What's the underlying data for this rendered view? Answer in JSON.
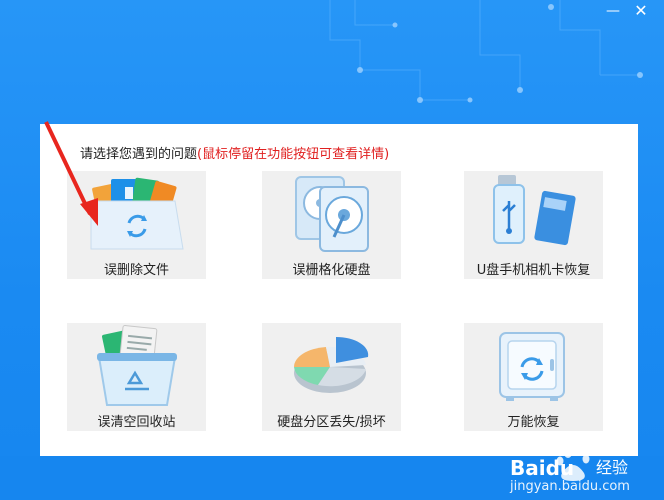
{
  "window": {
    "minimize_glyph": "—",
    "close_glyph": "✕"
  },
  "panel": {
    "prompt": "请选择您遇到的问题",
    "hint": "(鼠标停留在功能按钮可查看详情)"
  },
  "options": [
    {
      "label": "误删除文件",
      "icon": "folder-recycle-icon"
    },
    {
      "label": "误栅格化硬盘",
      "icon": "hard-disk-icon"
    },
    {
      "label": "U盘手机相机卡恢复",
      "icon": "usb-sdcard-icon"
    },
    {
      "label": "误清空回收站",
      "icon": "recycle-bin-icon"
    },
    {
      "label": "硬盘分区丢失/损坏",
      "icon": "partition-pie-icon"
    },
    {
      "label": "万能恢复",
      "icon": "safe-recovery-icon"
    }
  ],
  "watermark": {
    "brand": "Baidu",
    "brand_cn": "经验",
    "url": "jingyan.baidu.com"
  },
  "colors": {
    "title_blue": "#1a8cf3",
    "hint_red": "#e02020",
    "card_bg": "#f0f0f0",
    "arrow_red": "#e8261e"
  }
}
